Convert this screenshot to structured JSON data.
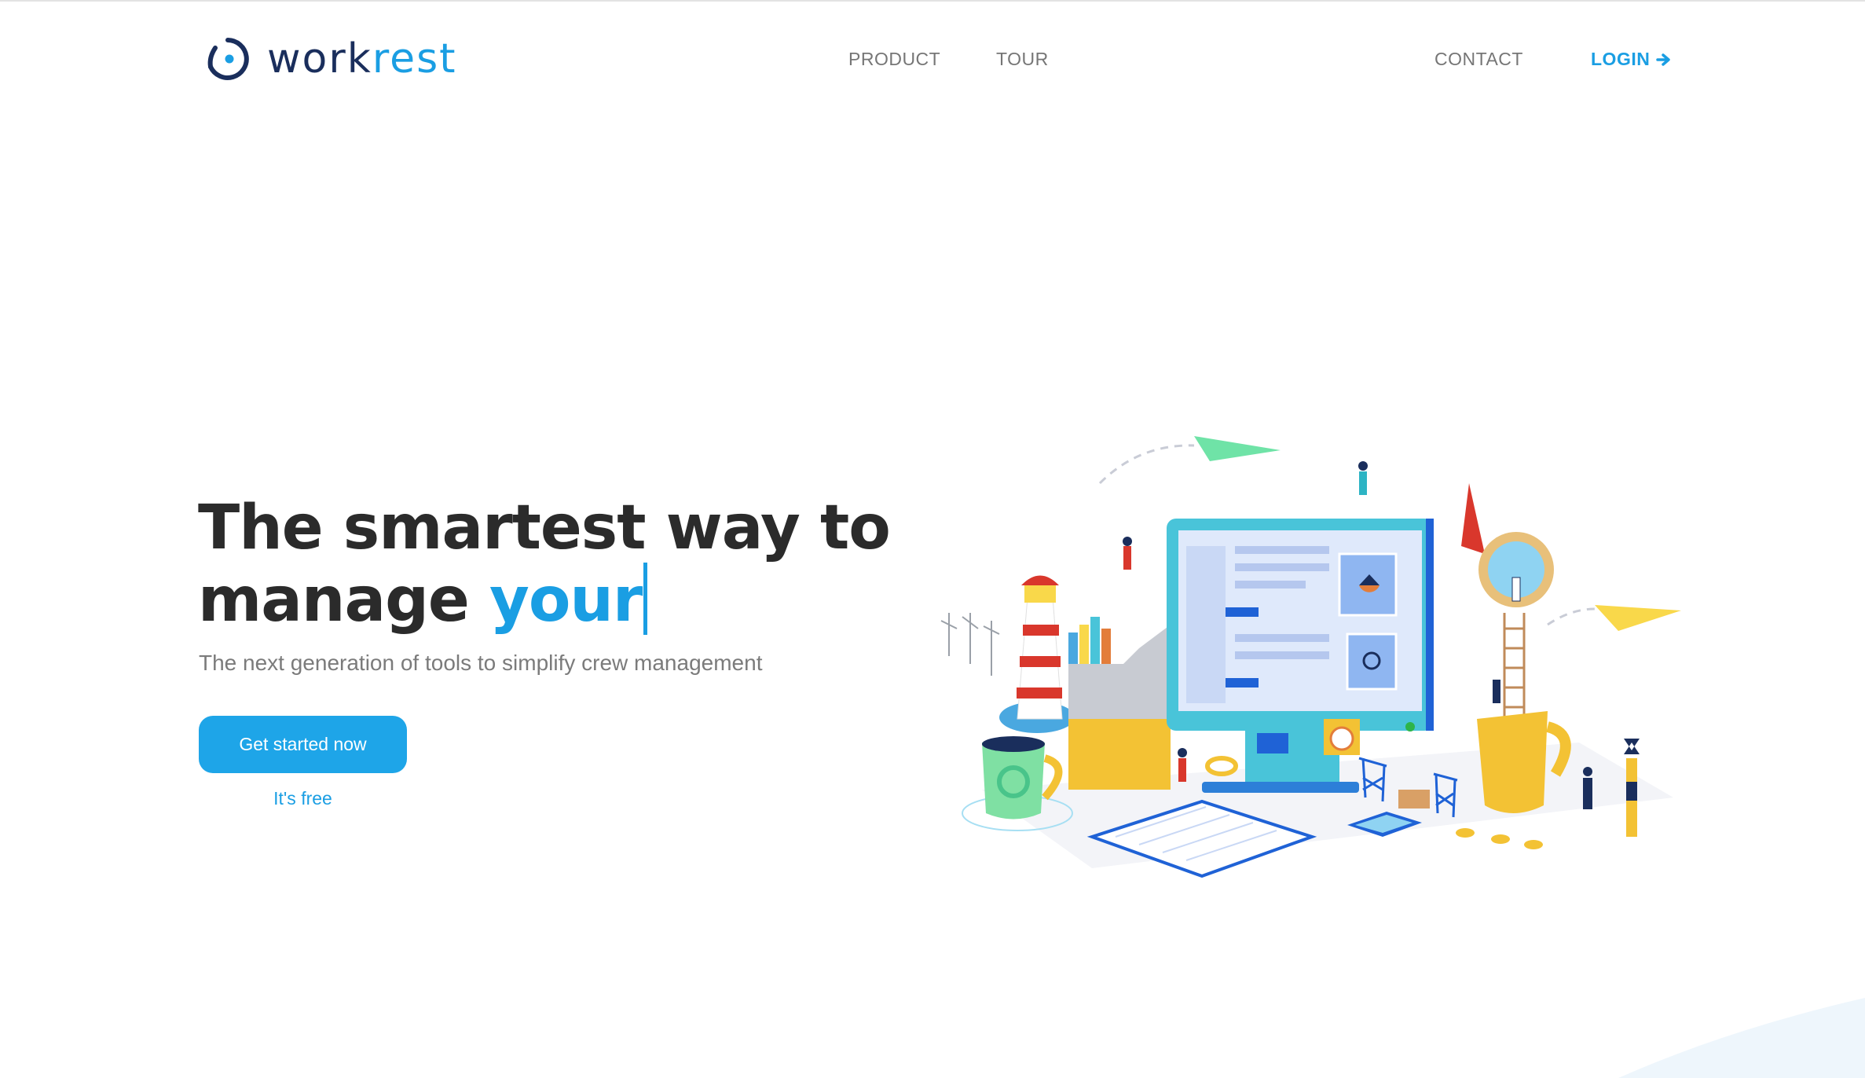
{
  "brand": {
    "name_part1": "work",
    "name_part2": "rest",
    "logo_icon": "workrest-logo-icon",
    "colors": {
      "navy": "#1a2e5c",
      "accent": "#1a9ee3"
    }
  },
  "nav": {
    "product": "PRODUCT",
    "tour": "TOUR",
    "contact": "CONTACT",
    "login": "LOGIN",
    "login_icon": "arrow-right-icon"
  },
  "hero": {
    "title_line1": "The smartest way to",
    "title_line2": "manage",
    "title_accent": "your",
    "subtitle": "The next generation of tools to simplify crew management",
    "cta_label": "Get started now",
    "cta_note": "It's free"
  },
  "illustration": {
    "description_icon": "crew-management-illustration"
  }
}
